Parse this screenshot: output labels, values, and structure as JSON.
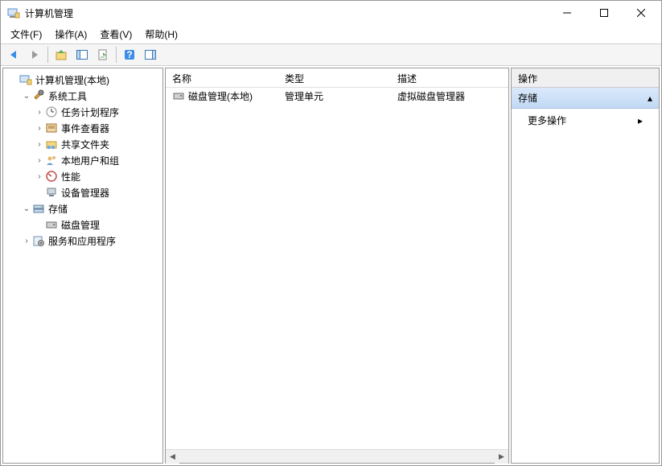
{
  "window": {
    "title": "计算机管理"
  },
  "menu": {
    "file": "文件(F)",
    "action": "操作(A)",
    "view": "查看(V)",
    "help": "帮助(H)"
  },
  "tree": {
    "root": "计算机管理(本地)",
    "systools": "系统工具",
    "sched": "任务计划程序",
    "event": "事件查看器",
    "shared": "共享文件夹",
    "users": "本地用户和组",
    "perf": "性能",
    "devmgr": "设备管理器",
    "storage": "存储",
    "diskmgr": "磁盘管理",
    "services": "服务和应用程序"
  },
  "list": {
    "cols": {
      "name": "名称",
      "type": "类型",
      "desc": "描述"
    },
    "row0": {
      "name": "磁盘管理(本地)",
      "type": "管理单元",
      "desc": "虚拟磁盘管理器"
    }
  },
  "actions": {
    "header": "操作",
    "cat": "存储",
    "more": "更多操作"
  }
}
